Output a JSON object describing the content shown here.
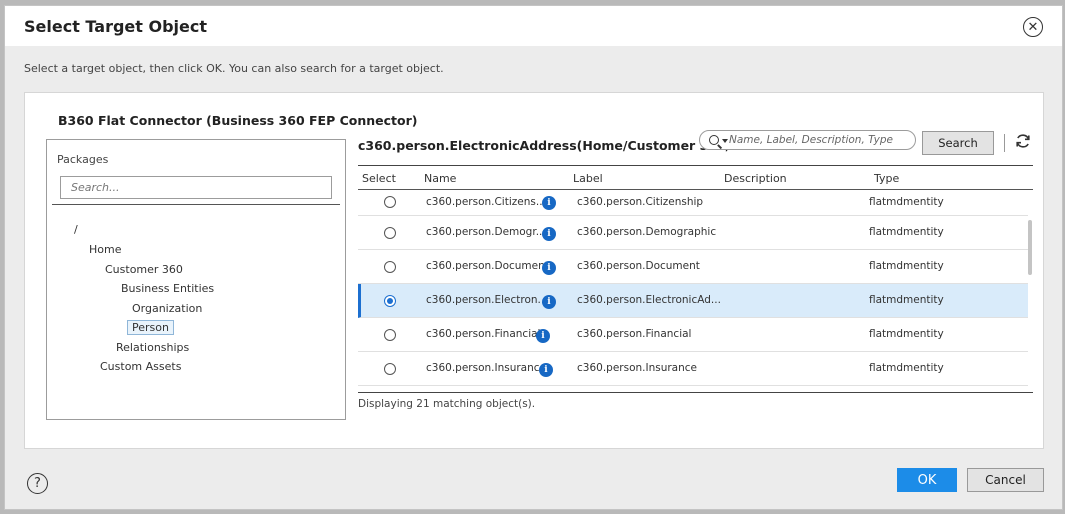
{
  "dialog": {
    "title": "Select Target Object",
    "instruction": "Select a target object, then click OK. You can also search for a target object."
  },
  "connection": {
    "title": "B360 Flat Connector (Business 360 FEP Connector)"
  },
  "packages": {
    "label": "Packages",
    "search_placeholder": "Search...",
    "tree": [
      {
        "label": "/"
      },
      {
        "label": "Home"
      },
      {
        "label": "Customer 360"
      },
      {
        "label": "Business Entities"
      },
      {
        "label": "Organization"
      },
      {
        "label": "Person",
        "selected": true
      },
      {
        "label": "Relationships"
      },
      {
        "label": "Custom Assets"
      }
    ]
  },
  "objects": {
    "path": "c360.person.ElectronicAddress(Home/Customer 360/...",
    "search_placeholder": "Name, Label, Description, Type",
    "search_button": "Search",
    "columns": {
      "select": "Select",
      "name": "Name",
      "label": "Label",
      "description": "Description",
      "type": "Type"
    },
    "rows": [
      {
        "name": "c360.person.Citizens...",
        "label": "c360.person.Citizenship",
        "description": "",
        "type": "flatmdmentity",
        "selected": false
      },
      {
        "name": "c360.person.Demogr...",
        "label": "c360.person.Demographic",
        "description": "",
        "type": "flatmdmentity",
        "selected": false
      },
      {
        "name": "c360.person.Document",
        "label": "c360.person.Document",
        "description": "",
        "type": "flatmdmentity",
        "selected": false
      },
      {
        "name": "c360.person.Electron...",
        "label": "c360.person.ElectronicAd...",
        "description": "",
        "type": "flatmdmentity",
        "selected": true
      },
      {
        "name": "c360.person.Financial",
        "label": "c360.person.Financial",
        "description": "",
        "type": "flatmdmentity",
        "selected": false
      },
      {
        "name": "c360.person.Insurance",
        "label": "c360.person.Insurance",
        "description": "",
        "type": "flatmdmentity",
        "selected": false
      }
    ],
    "status": "Displaying 21 matching object(s)."
  },
  "footer": {
    "help": "?",
    "ok": "OK",
    "cancel": "Cancel"
  },
  "icons": {
    "close": "close-circle-icon",
    "search": "magnifier-icon",
    "refresh": "refresh-icon",
    "info": "info-icon",
    "help": "help-icon"
  },
  "colors": {
    "accent": "#1c8ce8",
    "selected_row": "#d9ebfa",
    "info": "#1768c4"
  }
}
